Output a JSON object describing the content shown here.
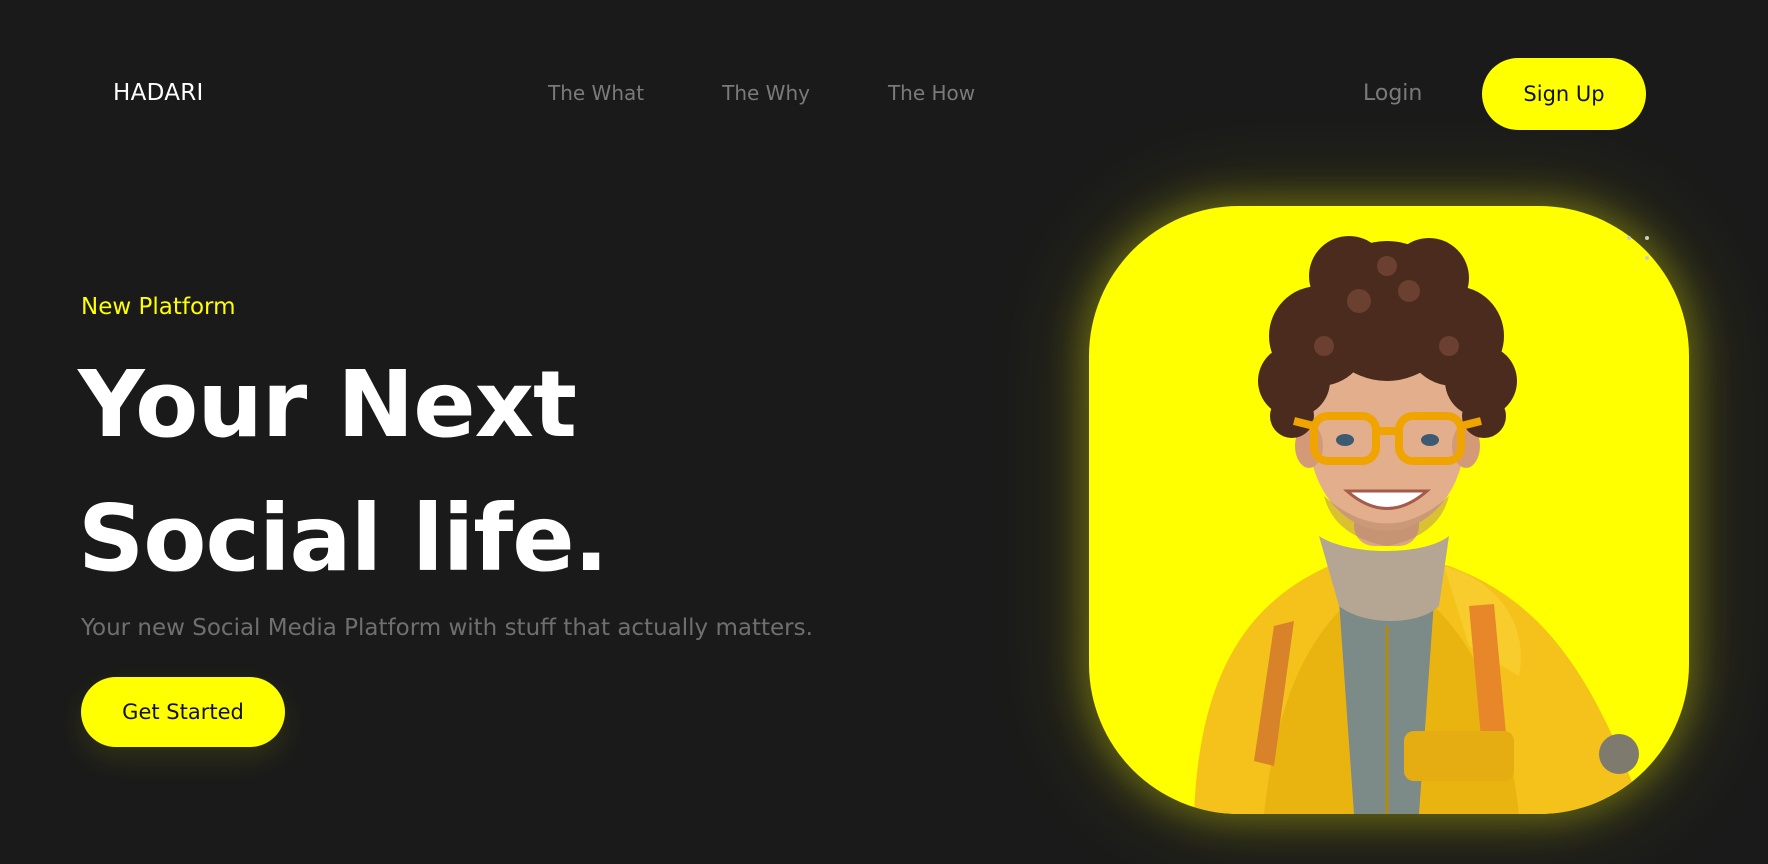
{
  "brand": {
    "name": "HADARI"
  },
  "nav": {
    "items": [
      {
        "label": "The What"
      },
      {
        "label": "The Why"
      },
      {
        "label": "The How"
      }
    ]
  },
  "auth": {
    "login_label": "Login",
    "signup_label": "Sign Up"
  },
  "hero": {
    "eyebrow": "New Platform",
    "headline_line1": "Your Next",
    "headline_line2": "Social life.",
    "subtitle": "Your new Social Media Platform with stuff that actually matters.",
    "cta_label": "Get Started",
    "image": {
      "icon": "avatar-illustration"
    }
  },
  "colors": {
    "background": "#1a1a1a",
    "accent": "#ffff00",
    "text_primary": "#ffffff",
    "text_muted": "#7a7a7a"
  }
}
